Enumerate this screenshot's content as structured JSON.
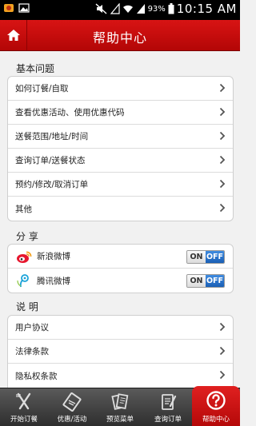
{
  "status_bar": {
    "battery": "93%",
    "time": "10:15 AM"
  },
  "header": {
    "title": "帮助中心"
  },
  "sections": {
    "basic": {
      "title": "基本问题",
      "items": [
        {
          "label": "如何订餐/自取"
        },
        {
          "label": "查看优惠活动、使用优惠代码"
        },
        {
          "label": "送餐范围/地址/时间"
        },
        {
          "label": "查询订单/送餐状态"
        },
        {
          "label": "预约/修改/取消订单"
        },
        {
          "label": "其他"
        }
      ]
    },
    "share": {
      "title": "分 享",
      "items": [
        {
          "label": "新浪微博",
          "icon": "sina-weibo-icon",
          "on_label": "ON",
          "off_label": "OFF",
          "state": "off"
        },
        {
          "label": "腾讯微博",
          "icon": "tencent-weibo-icon",
          "on_label": "ON",
          "off_label": "OFF",
          "state": "off"
        }
      ]
    },
    "about": {
      "title": "说 明",
      "items": [
        {
          "label": "用户协议"
        },
        {
          "label": "法律条款"
        },
        {
          "label": "隐私权条款"
        }
      ]
    }
  },
  "tabbar": {
    "items": [
      {
        "label": "开始订餐",
        "icon": "fork-knife-icon"
      },
      {
        "label": "优惠/活动",
        "icon": "coupon-icon"
      },
      {
        "label": "预览菜单",
        "icon": "menu-book-icon"
      },
      {
        "label": "查询订单",
        "icon": "order-list-icon"
      },
      {
        "label": "帮助中心",
        "icon": "help-icon",
        "active": true
      }
    ]
  },
  "colors": {
    "header_red": "#c90d0d",
    "toggle_blue": "#2a72cc",
    "tab_dark": "#3d3d3d"
  }
}
